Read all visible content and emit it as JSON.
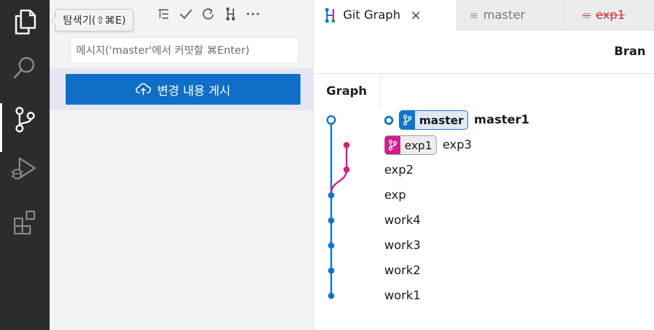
{
  "colors": {
    "activity_bg": "#2c2c2c",
    "sidebar_bg": "#f3f3f3",
    "accent_blue": "#0f6fc6",
    "graph_blue": "#0f75c8",
    "graph_magenta": "#d21d8e",
    "deleted_red": "#c8323c"
  },
  "activity_bar": {
    "items": [
      {
        "icon": "files-icon"
      },
      {
        "icon": "search-icon"
      },
      {
        "icon": "source-control-icon",
        "active": true
      },
      {
        "icon": "run-debug-icon"
      },
      {
        "icon": "extensions-icon"
      }
    ]
  },
  "tooltip": {
    "text": "탐색기(⇧⌘E)"
  },
  "sidebar": {
    "toolbar": [
      "list-tree-icon",
      "check-icon",
      "refresh-icon",
      "git-graph-icon",
      "more-icon"
    ],
    "commit_placeholder": "메시지('master'에서 커밋할 ⌘Enter)",
    "publish_label": "변경 내용 게시"
  },
  "tabs": [
    {
      "label": "Git Graph",
      "active": true,
      "close": "×"
    },
    {
      "label": "master"
    },
    {
      "label": "exp1",
      "deleted": true
    }
  ],
  "graph": {
    "branch_header": "Bran",
    "column_header": "Graph",
    "commits": [
      {
        "message": "master1",
        "refs": [
          {
            "name": "master",
            "type": "head"
          }
        ],
        "head": true
      },
      {
        "message": "exp3",
        "refs": [
          {
            "name": "exp1",
            "type": "branch"
          }
        ]
      },
      {
        "message": "exp2"
      },
      {
        "message": "exp"
      },
      {
        "message": "work4"
      },
      {
        "message": "work3"
      },
      {
        "message": "work2"
      },
      {
        "message": "work1"
      }
    ]
  }
}
